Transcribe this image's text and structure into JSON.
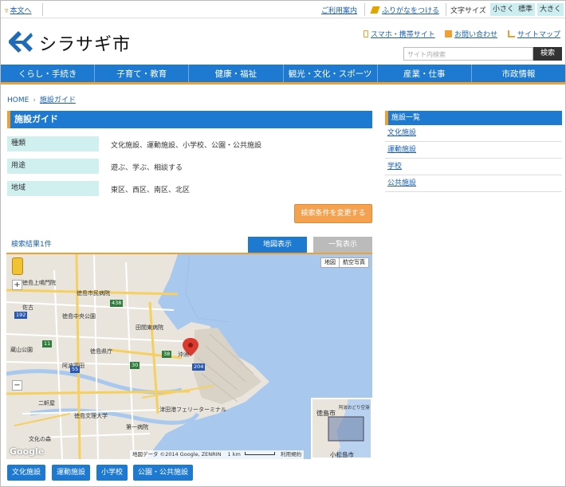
{
  "util": {
    "skip_link": "本文へ",
    "guide_link": "ご利用案内",
    "furigana_link": "ふりがなをつける",
    "font_size_label": "文字サイズ",
    "font_small": "小さく",
    "font_normal": "標準",
    "font_large": "大きく"
  },
  "header": {
    "site_name": "シラサギ市",
    "mobile_link": "スマホ・携帯サイト",
    "contact_link": "お問い合わせ",
    "sitemap_link": "サイトマップ",
    "search_placeholder": "サイト内検索",
    "search_button": "検索"
  },
  "nav": [
    "くらし・手続き",
    "子育て・教育",
    "健康・福祉",
    "観光・文化・スポーツ",
    "産業・仕事",
    "市政情報"
  ],
  "breadcrumb": {
    "home": "HOME",
    "current": "施設ガイド"
  },
  "main": {
    "title": "施設ガイド",
    "conditions": [
      {
        "label": "種類",
        "value": "文化施設、運動施設、小学校、公園・公共施設"
      },
      {
        "label": "用途",
        "value": "遊ぶ、学ぶ、相談する"
      },
      {
        "label": "地域",
        "value": "東区、西区、南区、北区"
      }
    ],
    "change_button": "検索条件を変更する",
    "result_count": "検索結果1件",
    "tab_map": "地図表示",
    "tab_list": "一覧表示"
  },
  "map": {
    "type_map": "地図",
    "type_satellite": "航空写真",
    "zoom_in": "+",
    "zoom_out": "−",
    "labels": [
      "徳島上鳴門院",
      "徳島市民病院",
      "徳島中央公園",
      "田間東病院",
      "徳島県庁",
      "阿波富田",
      "二軒屋",
      "徳島文理大学",
      "第一病院",
      "文化の森",
      "津田港フェリーターミナル",
      "沖洲",
      "佐古",
      "蔵山公園",
      "徳島市",
      "小松島市",
      "阿波おどり空港"
    ],
    "routes": [
      "192",
      "438",
      "11",
      "30",
      "55",
      "38",
      "204"
    ],
    "credit": "地図データ ©2014 Google, ZENRIN",
    "scale": "1 km",
    "terms": "利用規約",
    "google": "Google"
  },
  "chips": [
    "文化施設",
    "運動施設",
    "小学校",
    "公園・公共施設"
  ],
  "sidebar": {
    "title": "施設一覧",
    "items": [
      "文化施設",
      "運動施設",
      "学校",
      "公共施設"
    ]
  },
  "colors": {
    "accent": "#1e7ad1",
    "orange": "#f0a030",
    "cyan_bg": "#d0f0f0"
  }
}
